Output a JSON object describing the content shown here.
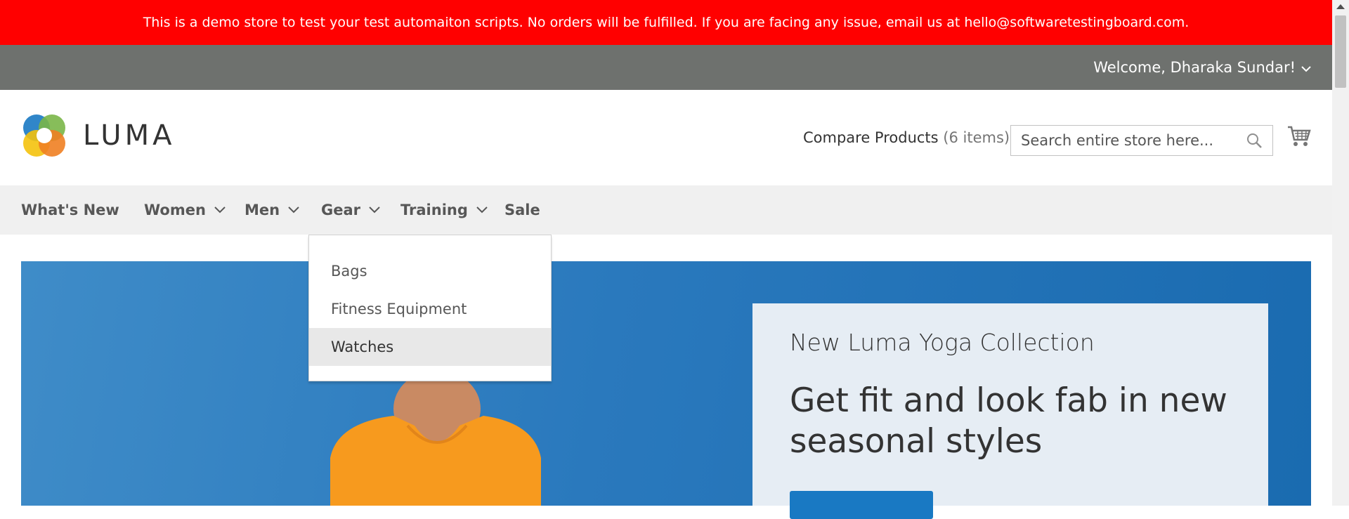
{
  "banner": {
    "text": "This is a demo store to test your test automaiton scripts. No orders will be fulfilled. If you are facing any issue, email us at hello@softwaretestingboard.com.",
    "bg_color": "#ff0000"
  },
  "panel": {
    "welcome": "Welcome, Dharaka Sundar!",
    "bg_color": "#6e716e"
  },
  "header": {
    "logo_text": "LUMA",
    "compare_label": "Compare Products",
    "compare_count": "(6 items)",
    "search_placeholder": "Search entire store here...",
    "icons": [
      "search-icon",
      "cart-icon"
    ]
  },
  "nav": {
    "items": [
      {
        "label": "What's New",
        "has_dropdown": false
      },
      {
        "label": "Women",
        "has_dropdown": true
      },
      {
        "label": "Men",
        "has_dropdown": true
      },
      {
        "label": "Gear",
        "has_dropdown": true
      },
      {
        "label": "Training",
        "has_dropdown": true
      },
      {
        "label": "Sale",
        "has_dropdown": false
      }
    ]
  },
  "gear_menu": {
    "items": [
      "Bags",
      "Fitness Equipment",
      "Watches"
    ],
    "highlighted": "Watches"
  },
  "hero": {
    "subtitle": "New Luma Yoga Collection",
    "title": "Get fit and look fab in new seasonal styles",
    "accent_color": "#1979c3"
  }
}
